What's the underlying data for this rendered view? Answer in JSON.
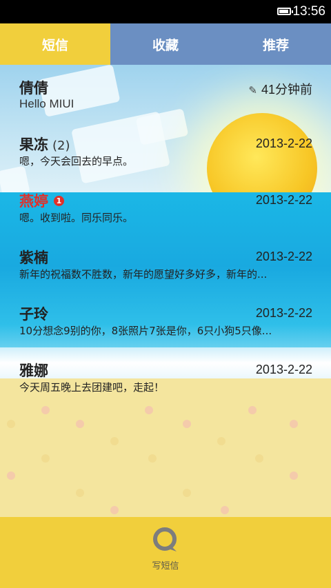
{
  "status_bar": {
    "time": "13:56",
    "battery_level": 0.9
  },
  "tabs": [
    {
      "label": "短信",
      "active": true
    },
    {
      "label": "收藏",
      "active": false
    },
    {
      "label": "推荐",
      "active": false
    }
  ],
  "messages": [
    {
      "name": "倩倩",
      "count": "",
      "unread_badge": "",
      "time": "41分钟前",
      "preview": "Hello MIUI",
      "draft_icon": "pencil-icon"
    },
    {
      "name": "果冻",
      "count": "(2)",
      "unread_badge": "",
      "time": "2013-2-22",
      "preview": "嗯，今天会回去的早点。"
    },
    {
      "name": "燕婷",
      "count": "",
      "unread_badge": "1",
      "time": "2013-2-22",
      "preview": "嗯。收到啦。同乐同乐。"
    },
    {
      "name": "紫楠",
      "count": "",
      "unread_badge": "",
      "time": "2013-2-22",
      "preview": "新年的祝福数不胜数，新年的愿望好多好多，新年的..."
    },
    {
      "name": "子玲",
      "count": "",
      "unread_badge": "",
      "time": "2013-2-22",
      "preview": "10分想念9别的你，8张照片7张是你，6只小狗5只像..."
    },
    {
      "name": "雅娜",
      "count": "",
      "unread_badge": "",
      "time": "2013-2-22",
      "preview": "今天周五晚上去团建吧，走起！"
    }
  ],
  "bottom_bar": {
    "compose_label": "写短信",
    "compose_icon": "speech-bubble-icon"
  },
  "colors": {
    "tab_active": "#f1cf3c",
    "tab_inactive": "#6b8fc2",
    "unread_name": "#e0302a",
    "bottom_bar": "#f1cf3c"
  }
}
